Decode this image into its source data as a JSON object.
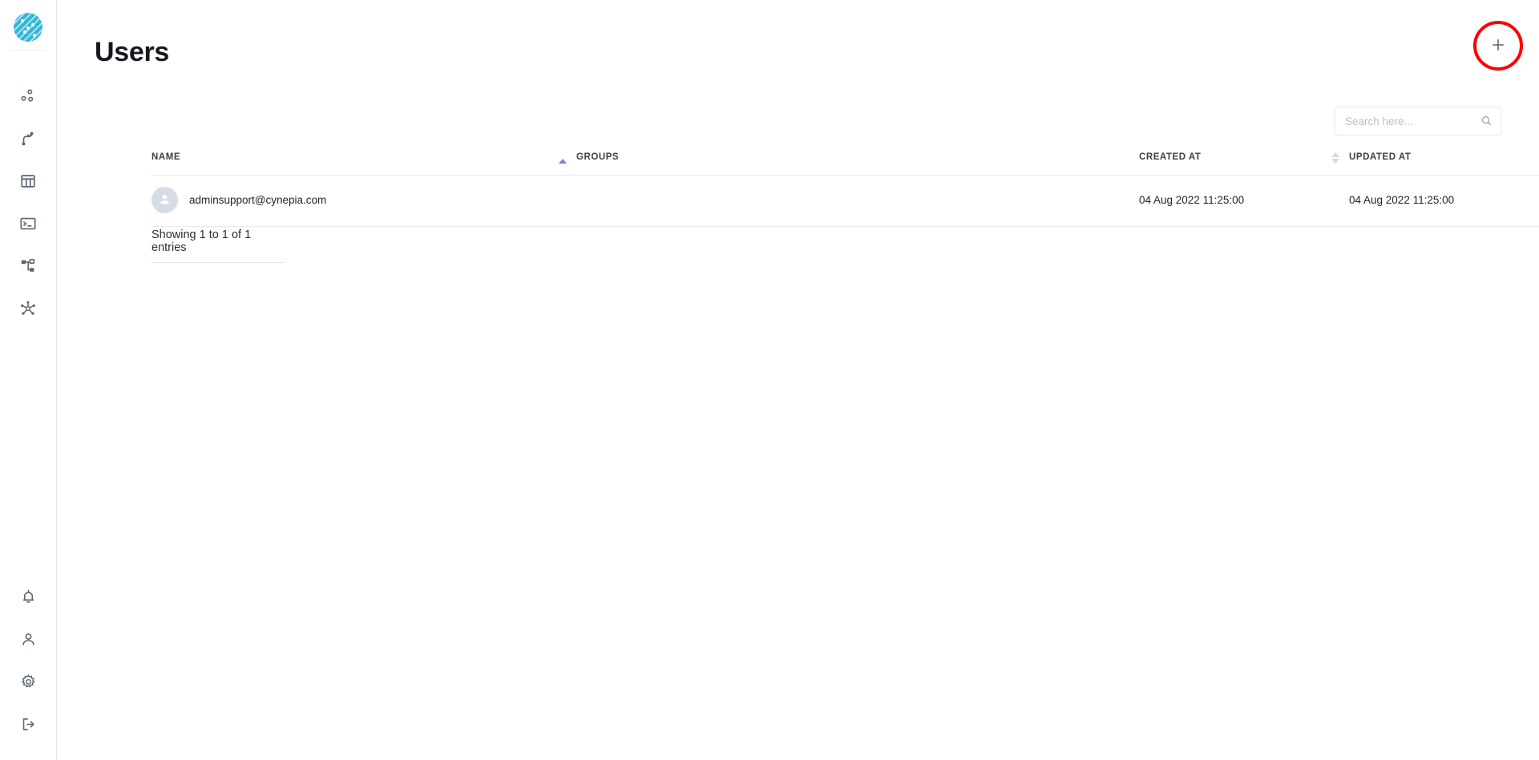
{
  "app": {
    "logo_name": "cynepia-logo",
    "accent_color": "#35b5d8",
    "highlight_color": "#fe0000",
    "sort_active_color": "#7b7fd4"
  },
  "sidebar": {
    "collapse_label": "chevron-right-icon",
    "top_items": [
      {
        "icon": "cluster-nodes-icon",
        "label": "Clusters"
      },
      {
        "icon": "pipeline-flow-icon",
        "label": "Pipelines"
      },
      {
        "icon": "table-grid-icon",
        "label": "Tables"
      },
      {
        "icon": "terminal-icon",
        "label": "Console"
      },
      {
        "icon": "sitemap-icon",
        "label": "Workflows"
      },
      {
        "icon": "network-graph-icon",
        "label": "Network"
      }
    ],
    "bottom_items": [
      {
        "icon": "bell-icon",
        "label": "Notifications"
      },
      {
        "icon": "person-icon",
        "label": "Account"
      },
      {
        "icon": "gear-icon",
        "label": "Settings"
      },
      {
        "icon": "logout-icon",
        "label": "Sign out"
      }
    ]
  },
  "header": {
    "title": "Users",
    "add_button_label": "+",
    "add_button_name": "add-user-button"
  },
  "search": {
    "placeholder": "Search here...",
    "value": "",
    "icon": "search-icon"
  },
  "table": {
    "columns": [
      {
        "key": "name",
        "label": "NAME",
        "sort": "asc"
      },
      {
        "key": "groups",
        "label": "GROUPS",
        "sort": "none"
      },
      {
        "key": "created",
        "label": "CREATED AT",
        "sort": "both"
      },
      {
        "key": "updated",
        "label": "UPDATED AT",
        "sort": "both"
      }
    ],
    "rows": [
      {
        "avatar": "user-avatar-icon",
        "name": "adminsupport@cynepia.com",
        "groups": "",
        "created": "04 Aug 2022 11:25:00",
        "updated": "04 Aug 2022 11:25:00"
      }
    ],
    "footer": "Showing 1 to 1 of 1 entries"
  }
}
